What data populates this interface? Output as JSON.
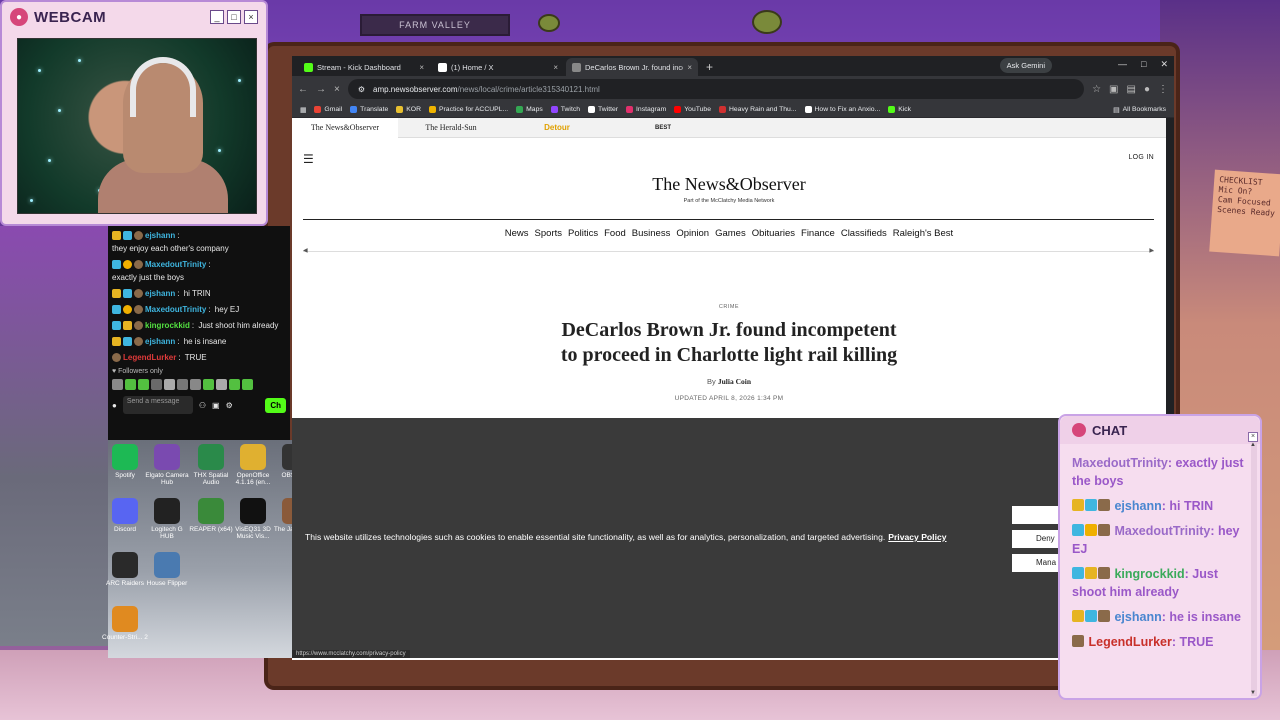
{
  "webcam": {
    "title": "WEBCAM"
  },
  "background": {
    "shelf_label": "FARM VALLEY",
    "note_text": [
      "CHECKLIST",
      "Mic On?",
      "Cam Focused",
      "Scenes Ready"
    ]
  },
  "left_chat": {
    "messages": [
      {
        "user": "ejshann",
        "user_color": "#3fb6e0",
        "text": "they enjoy each other's company",
        "badges": [
          "crown",
          "sub",
          "cat"
        ]
      },
      {
        "user": "MaxedoutTrinity",
        "user_color": "#3fb6e0",
        "text": "exactly just the boys",
        "badges": [
          "sub",
          "coin",
          "cat"
        ]
      },
      {
        "user": "ejshann",
        "user_color": "#3fb6e0",
        "text": "hi TRIN",
        "badges": [
          "crown",
          "sub",
          "cat"
        ]
      },
      {
        "user": "MaxedoutTrinity",
        "user_color": "#3fb6e0",
        "text": "hey EJ",
        "badges": [
          "sub",
          "coin",
          "cat"
        ]
      },
      {
        "user": "kingrockkid",
        "user_color": "#53e040",
        "text": "Just shoot him already",
        "badges": [
          "sword",
          "crown",
          "cat"
        ]
      },
      {
        "user": "ejshann",
        "user_color": "#3fb6e0",
        "text": "he is insane",
        "badges": [
          "crown",
          "sub",
          "cat"
        ]
      },
      {
        "user": "LegendLurker",
        "user_color": "#e03a3a",
        "text": "TRUE",
        "badges": [
          "cat"
        ]
      }
    ],
    "followers_only": "Followers only",
    "input_placeholder": "Send a message",
    "chat_button": "Ch"
  },
  "desktop_icons": [
    {
      "label": "Spotify",
      "color": "#1db954"
    },
    {
      "label": "Elgato Camera Hub",
      "color": "#7a4ab0"
    },
    {
      "label": "THX Spatial Audio",
      "color": "#2a8a4a"
    },
    {
      "label": "OpenOffice 4.1.16 (en...",
      "color": "#e0b030"
    },
    {
      "label": "OBS St...",
      "color": "#333333"
    },
    {
      "label": "Discord",
      "color": "#5865f2"
    },
    {
      "label": "Logitech G HUB",
      "color": "#222222"
    },
    {
      "label": "REAPER (x64)",
      "color": "#3a8a3a"
    },
    {
      "label": "VisEQ31 3D Music Vis...",
      "color": "#111111"
    },
    {
      "label": "The Ja... Party ...",
      "color": "#8a5a3a"
    },
    {
      "label": "ARC Raiders",
      "color": "#2a2a2a"
    },
    {
      "label": "House Flipper",
      "color": "#4a7ab0"
    },
    {
      "label": "Counter-Stri... 2",
      "color": "#e08a20"
    }
  ],
  "browser": {
    "tabs": [
      {
        "label": "Stream - Kick Dashboard",
        "active": false,
        "icon": "kick-icon"
      },
      {
        "label": "(1) Home / X",
        "active": false,
        "icon": "x-icon"
      },
      {
        "label": "DeCarlos Brown Jr. found incom",
        "active": true,
        "icon": "newsobserver-icon"
      }
    ],
    "gemini_label": "Ask Gemini",
    "url_host": "amp.newsobserver.com",
    "url_path": "/news/local/crime/article315340121.html",
    "bookmarks": [
      {
        "label": "Gmail",
        "color": "#ea4335"
      },
      {
        "label": "Translate",
        "color": "#4285f4"
      },
      {
        "label": "KOR",
        "color": "#e8c030"
      },
      {
        "label": "Practice for ACCUPL...",
        "color": "#f0b400"
      },
      {
        "label": "Maps",
        "color": "#34a853"
      },
      {
        "label": "Twitch",
        "color": "#9146ff"
      },
      {
        "label": "Twitter",
        "color": "#ffffff"
      },
      {
        "label": "Instagram",
        "color": "#e1306c"
      },
      {
        "label": "YouTube",
        "color": "#ff0000"
      },
      {
        "label": "Heavy Rain and Thu...",
        "color": "#d03030"
      },
      {
        "label": "How to Fix an Anxio...",
        "color": "#ffffff"
      },
      {
        "label": "Kick",
        "color": "#53fc18"
      }
    ],
    "all_bookmarks": "All Bookmarks",
    "status_url": "https://www.mcclatchy.com/privacy-policy"
  },
  "page": {
    "network_sites": [
      "The News&Observer",
      "The Herald-Sun",
      "Detour",
      "BEST"
    ],
    "login": "LOG IN",
    "logo": "The News&Observer",
    "logo_sub": "Part of the McClatchy Media Network",
    "nav": [
      "News",
      "Sports",
      "Politics",
      "Food",
      "Business",
      "Opinion",
      "Games",
      "Obituaries",
      "Finance",
      "Classifieds",
      "Raleigh's Best"
    ],
    "kicker": "CRIME",
    "headline_line1": "DeCarlos Brown Jr. found incompetent",
    "headline_line2": "to proceed in Charlotte light rail killing",
    "byline_prefix": "By",
    "author": "Julia Coin",
    "updated": "UPDATED APRIL 8, 2026 1:34 PM"
  },
  "cookie_banner": {
    "text": "This website utilizes technologies such as cookies to enable essential site functionality, as well as for analytics, personalization, and targeted advertising.",
    "link": "Privacy Policy",
    "buttons": [
      "",
      "Deny",
      "Mana"
    ]
  },
  "chat_widget": {
    "title": "CHAT",
    "messages": [
      {
        "user": "MaxedoutTrinity",
        "text": "exactly just the boys",
        "user_color": "#9a6ac8"
      },
      {
        "user": "ejshann",
        "text": "hi TRIN",
        "user_color": "#4a86d0"
      },
      {
        "user": "MaxedoutTrinity",
        "text": "hey EJ",
        "user_color": "#9a6ac8"
      },
      {
        "user": "kingrockkid",
        "text": "Just shoot him already",
        "user_color": "#3aaa5a"
      },
      {
        "user": "ejshann",
        "text": "he is insane",
        "user_color": "#4a86d0"
      },
      {
        "user": "LegendLurker",
        "text": "TRUE",
        "user_color": "#c8302a"
      }
    ]
  }
}
